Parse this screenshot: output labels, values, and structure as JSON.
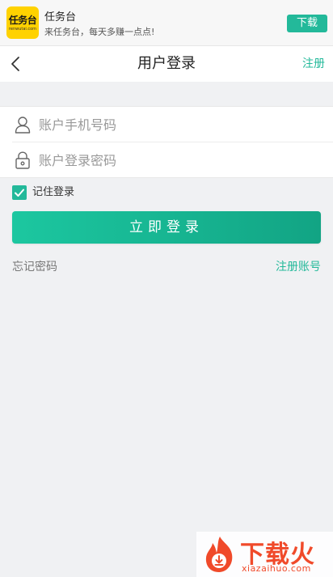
{
  "ad": {
    "logo_text": "任务台",
    "logo_subtext": "renwutai.com",
    "title": "任务台",
    "description": "来任务台，每天多赚一点点!",
    "download_label": "下载"
  },
  "header": {
    "title": "用户登录",
    "register_label": "注册",
    "back_icon": "chevron-left-icon"
  },
  "form": {
    "account": {
      "placeholder": "账户手机号码",
      "value": "",
      "icon": "user-icon"
    },
    "password": {
      "placeholder": "账户登录密码",
      "value": "",
      "icon": "lock-icon"
    }
  },
  "remember": {
    "label": "记住登录",
    "checked": true
  },
  "login_button": {
    "label": "立即登录"
  },
  "links": {
    "forgot_password": "忘记密码",
    "register_account": "注册账号"
  },
  "watermark": {
    "text": "下载火",
    "url": "xiazaihuo.com"
  },
  "colors": {
    "accent": "#23b99a",
    "background": "#f0f1f3",
    "watermark": "#f04a2a"
  }
}
